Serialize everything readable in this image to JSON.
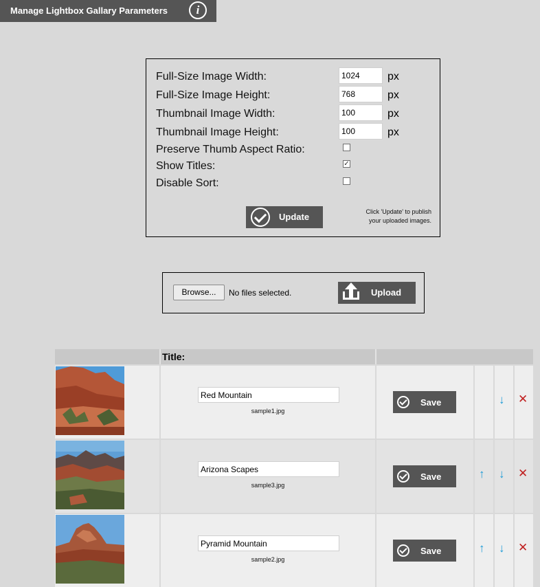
{
  "header": {
    "title": "Manage Lightbox Gallary Parameters",
    "info_icon": "info-icon"
  },
  "params": {
    "fields": [
      {
        "label": "Full-Size Image Width:",
        "value": "1024",
        "unit": "px"
      },
      {
        "label": "Full-Size Image Height:",
        "value": "768",
        "unit": "px"
      },
      {
        "label": "Thumbnail Image Width:",
        "value": "100",
        "unit": "px"
      },
      {
        "label": "Thumbnail Image Height:",
        "value": "100",
        "unit": "px"
      }
    ],
    "checkboxes": [
      {
        "label": "Preserve Thumb Aspect Ratio:",
        "checked": false
      },
      {
        "label": "Show Titles:",
        "checked": true
      },
      {
        "label": "Disable Sort:",
        "checked": false
      }
    ],
    "update_label": "Update",
    "note_line1": "Click 'Update' to publish",
    "note_line2": "your uploaded images."
  },
  "upload": {
    "browse_label": "Browse...",
    "status": "No files selected.",
    "upload_label": "Upload"
  },
  "table": {
    "title_header": "Title:",
    "rows": [
      {
        "title": "Red Mountain",
        "file": "sample1.jpg",
        "save_label": "Save",
        "up": false,
        "down": true
      },
      {
        "title": "Arizona Scapes",
        "file": "sample3.jpg",
        "save_label": "Save",
        "up": true,
        "down": true
      },
      {
        "title": "Pyramid Mountain",
        "file": "sample2.jpg",
        "save_label": "Save",
        "up": true,
        "down": true
      }
    ]
  },
  "icons": {
    "up": "↑",
    "down": "↓",
    "delete": "✕"
  },
  "colors": {
    "dark_button": "#555555",
    "arrow": "#1a9ad6",
    "delete": "#c02020",
    "background": "#d9d9d9"
  }
}
